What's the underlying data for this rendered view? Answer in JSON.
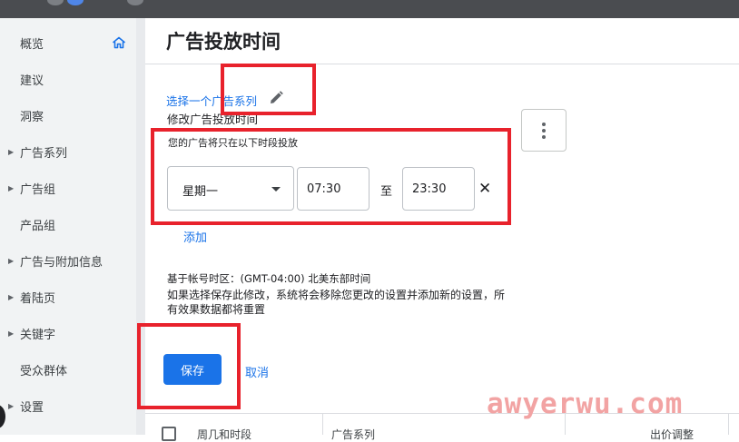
{
  "sidebar": {
    "items": [
      {
        "label": "概览",
        "caret": false
      },
      {
        "label": "建议",
        "caret": false
      },
      {
        "label": "洞察",
        "caret": false
      },
      {
        "label": "广告系列",
        "caret": true
      },
      {
        "label": "广告组",
        "caret": true
      },
      {
        "label": "产品组",
        "caret": false
      },
      {
        "label": "广告与附加信息",
        "caret": true
      },
      {
        "label": "着陆页",
        "caret": true
      },
      {
        "label": "关键字",
        "caret": true
      },
      {
        "label": "受众群体",
        "caret": false
      },
      {
        "label": "设置",
        "caret": true
      }
    ],
    "active_icon": "home-icon"
  },
  "main": {
    "title": "广告投放时间",
    "campaign_link": "选择一个广告系列",
    "subtitle": "修改广告投放时间",
    "schedule_note": "您的广告将只在以下时段投放",
    "schedule_row": {
      "day": "星期一",
      "start": "07:30",
      "to_label": "至",
      "end": "23:30",
      "remove_symbol": "✕"
    },
    "add_label": "添加",
    "timezone_note": "基于帐号时区：(GMT-04:00) 北美东部时间",
    "warning": "如果选择保存此修改，系统将会移除您更改的设置并添加新的设置，所有效果数据都将重置",
    "save_label": "保存",
    "cancel_label": "取消"
  },
  "table": {
    "columns": [
      "周几和时段",
      "广告系列",
      "出价调整"
    ]
  },
  "watermark": "awyerwu.com",
  "colors": {
    "accent": "#1a73e8",
    "annotation_red": "#e8222c",
    "sidebar_bg": "#f1f3f4",
    "topbar": "#4a4c50"
  }
}
